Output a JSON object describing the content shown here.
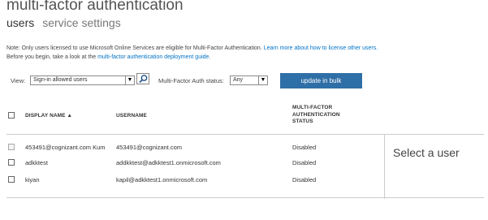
{
  "header": {
    "title": "multi-factor authentication",
    "tabs": [
      {
        "label": "users",
        "active": true
      },
      {
        "label": "service settings",
        "active": false
      }
    ]
  },
  "note": {
    "line1_text": "Note: Only users licensed to use Microsoft Online Services are eligible for Multi-Factor Authentication. ",
    "line1_link": "Learn more about how to license other users.",
    "line2_text": "Before you begin, take a look at the ",
    "line2_link": "multi-factor authentication deployment guide."
  },
  "toolbar": {
    "view_label": "View:",
    "view_value": "Sign-in allowed users",
    "status_label": "Multi-Factor Auth status:",
    "status_value": "Any",
    "bulk_button": "update in bulk"
  },
  "table": {
    "columns": [
      "DISPLAY NAME ▲",
      "USERNAME",
      "MULTI-FACTOR\nAUTHENTICATION\nSTATUS"
    ],
    "rows": [
      {
        "display_name": "453491@cognizant.com Kum",
        "username": "453491@cognizant.com",
        "status": "Disabled"
      },
      {
        "display_name": "adkktest",
        "username": "addkktest@adkktest1.onmicrosoft.com",
        "status": "Disabled"
      },
      {
        "display_name": "kiyan",
        "username": "kapil@adkktest1.onmicrosoft.com",
        "status": "Disabled"
      }
    ]
  },
  "side_panel": {
    "text": "Select a user"
  },
  "colors": {
    "accent": "#2f6fa7",
    "link": "#0072c6"
  },
  "icons": {
    "search": "search-icon",
    "dropdown": "chevron-down-icon"
  }
}
